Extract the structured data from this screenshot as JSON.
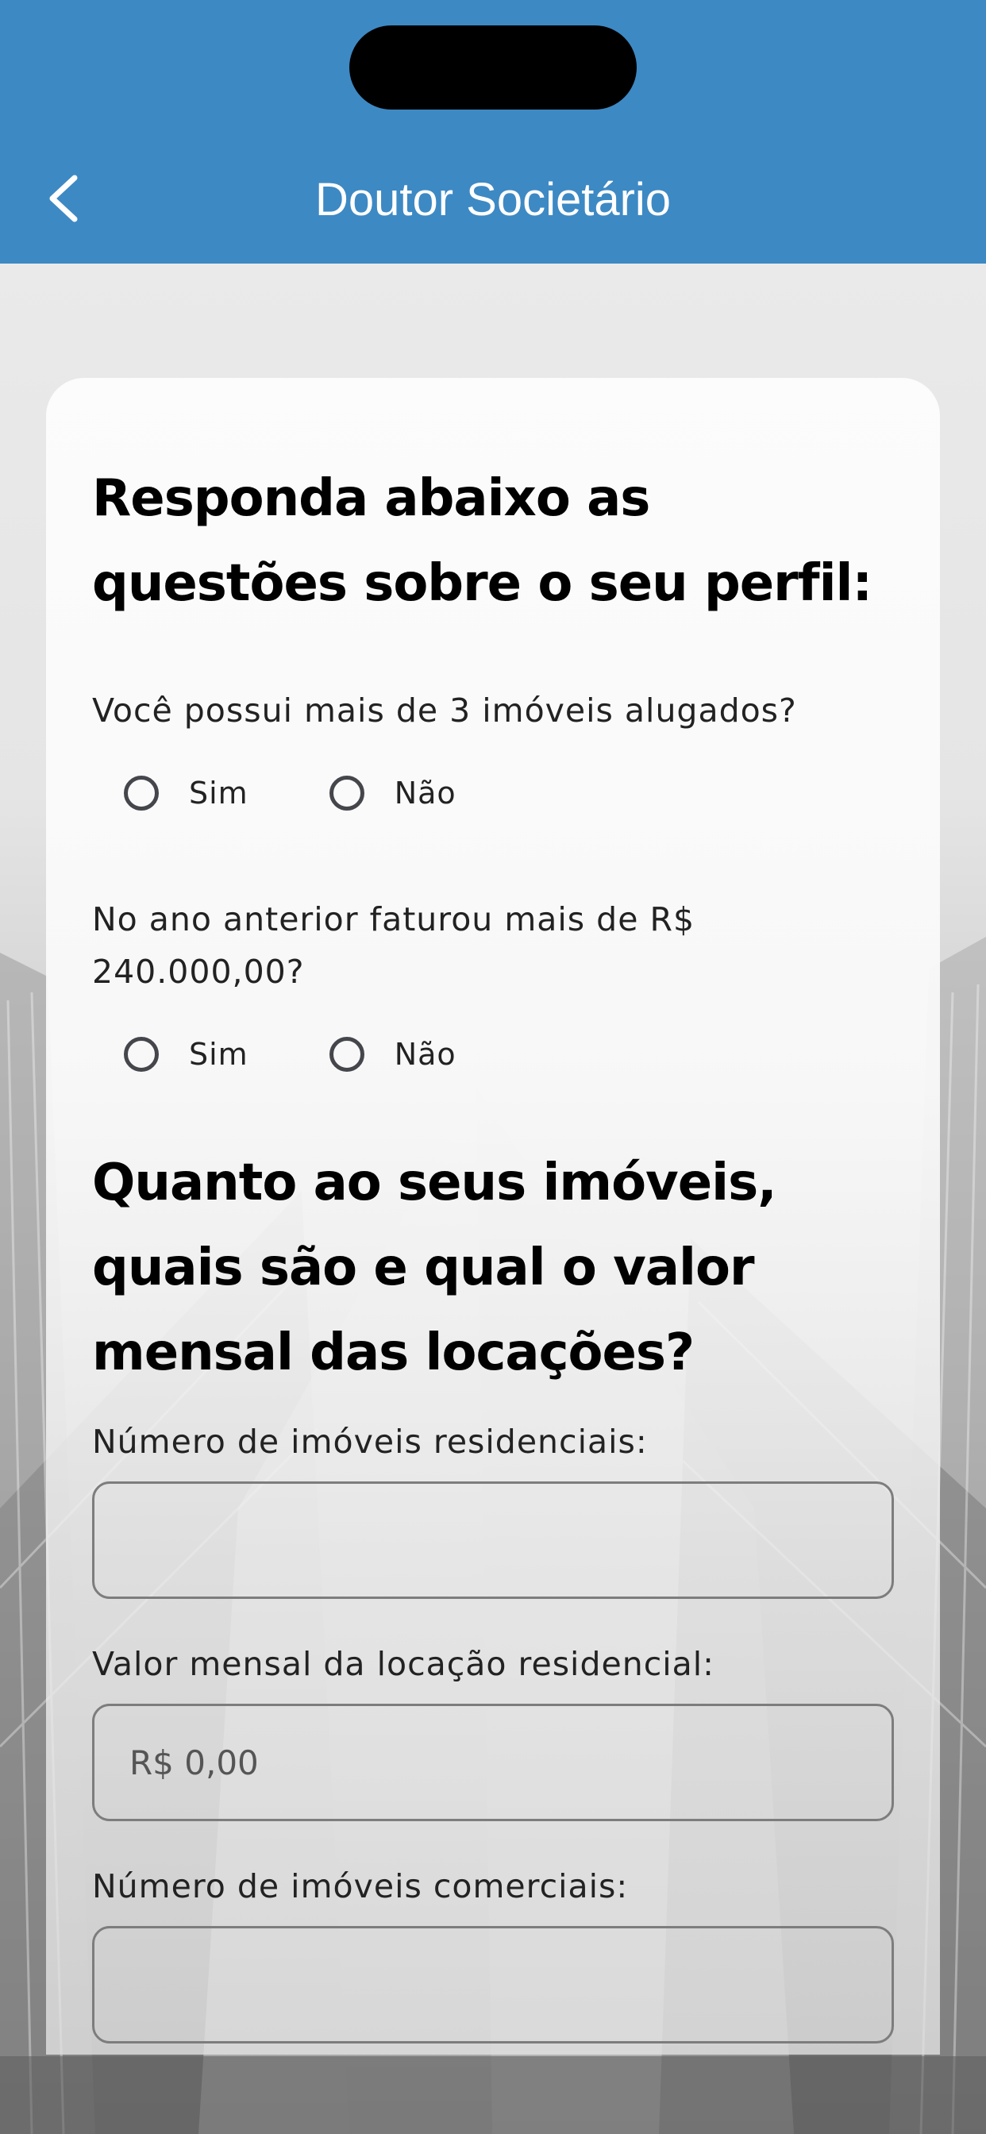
{
  "header": {
    "title": "Doutor Societário",
    "back_icon": "chevron-left-icon",
    "background_color": "#3d89c4"
  },
  "profile_section": {
    "heading": "Responda abaixo as questões sobre o seu perfil:",
    "questions": [
      {
        "text": "Você possui mais de 3 imóveis alugados?",
        "options": [
          "Sim",
          "Não"
        ],
        "selected": null
      },
      {
        "text": "No ano anterior faturou mais de R$ 240.000,00?",
        "options": [
          "Sim",
          "Não"
        ],
        "selected": null
      }
    ]
  },
  "properties_section": {
    "heading": "Quanto ao seus imóveis, quais são e qual o valor mensal das locações?",
    "fields": [
      {
        "label": "Número de imóveis residenciais:",
        "value": "",
        "placeholder": ""
      },
      {
        "label": "Valor mensal da locação residencial:",
        "value": "",
        "placeholder": "R$ 0,00"
      },
      {
        "label": "Número de imóveis comerciais:",
        "value": "",
        "placeholder": ""
      }
    ]
  }
}
